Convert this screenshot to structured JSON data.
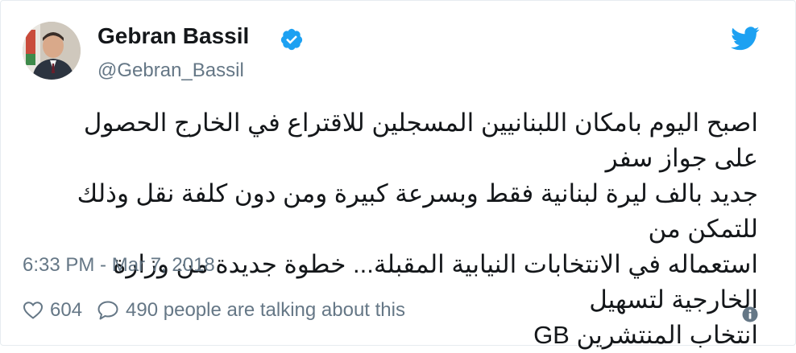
{
  "author": {
    "name": "Gebran Bassil",
    "handle": "@Gebran_Bassil",
    "verified": true
  },
  "tweet": {
    "text": "اصبح اليوم بامكان اللبنانيين المسجلين للاقتراع في الخارج الحصول على جواز سفر\nجديد بالف ليرة لبنانية فقط وبسرعة كبيرة ومن دون كلفة نقل وذلك للتمكن من\nاستعماله في الانتخابات النيابية المقبلة... خطوة جديدة من وزارة الخارجية لتسهيل\nانتخاب المنتشرين GB",
    "timestamp": "6:33 PM - Mar 7, 2018"
  },
  "actions": {
    "likes": "604",
    "talking": "490 people are talking about this"
  },
  "colors": {
    "brand": "#1da1f2",
    "text_primary": "#14171a",
    "text_secondary": "#657786"
  },
  "icons": [
    "verified-badge-icon",
    "twitter-bird-icon",
    "heart-icon",
    "comment-bubble-icon",
    "info-icon"
  ]
}
